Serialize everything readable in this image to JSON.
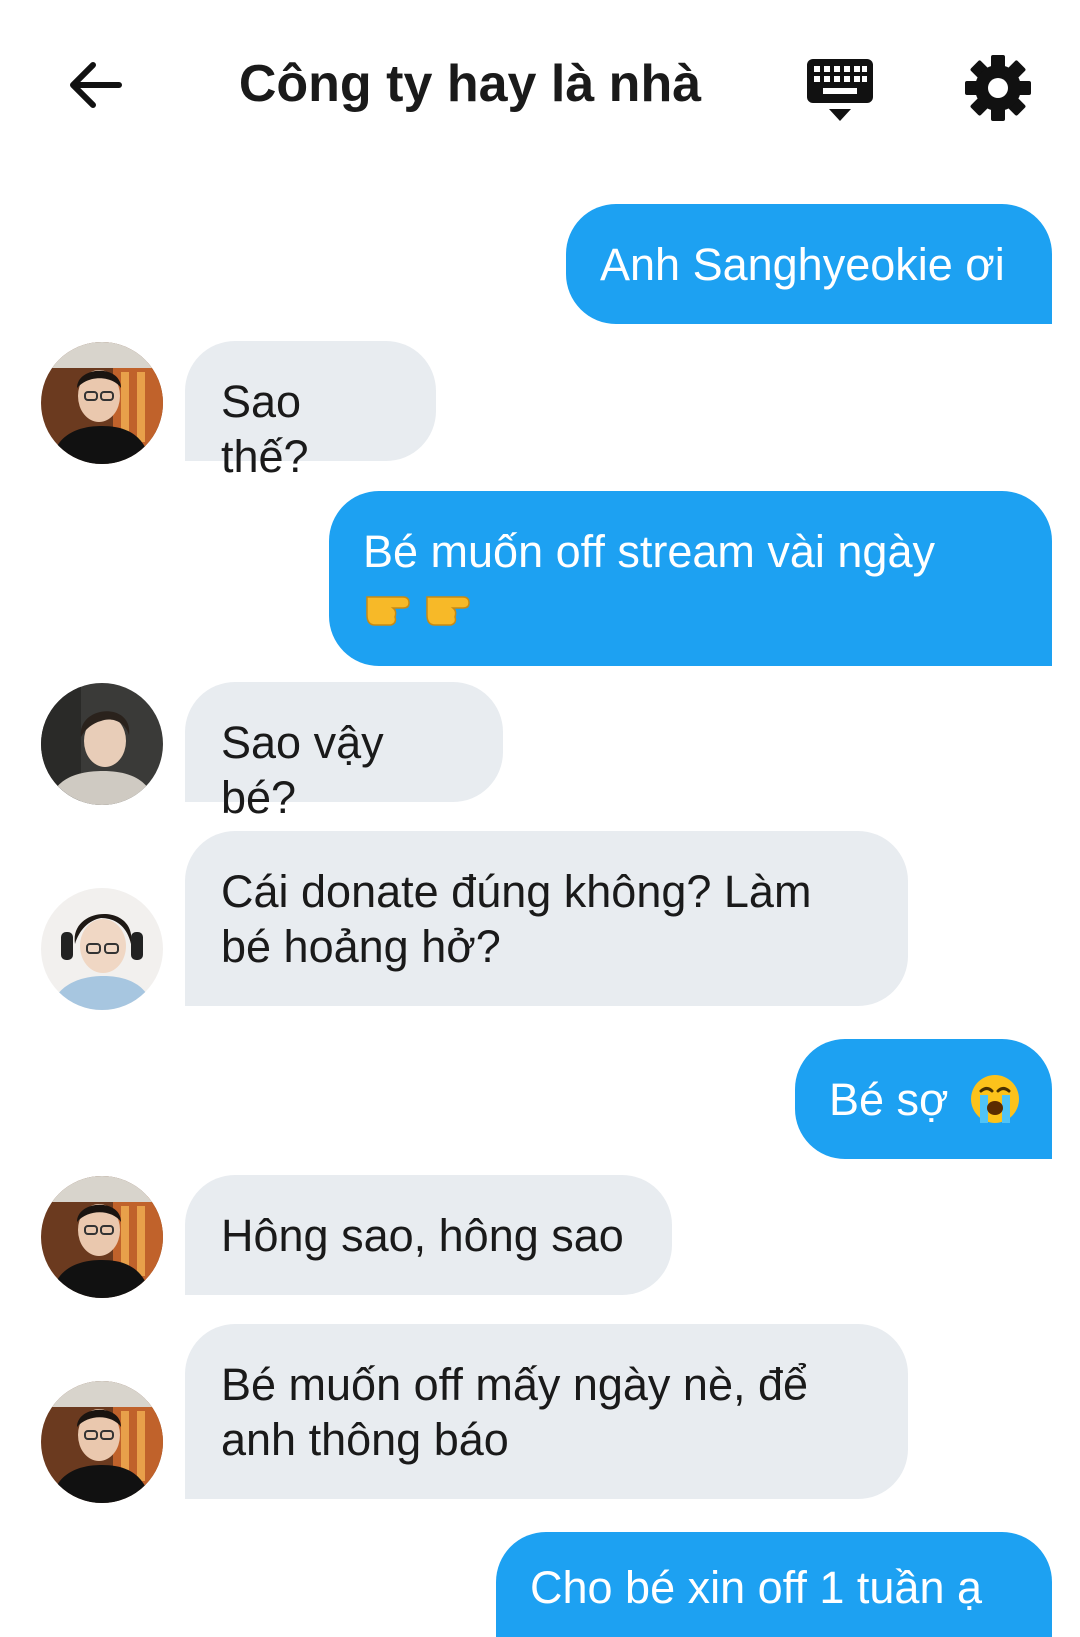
{
  "header": {
    "title": "Công ty hay là nhà",
    "back_icon": "arrow-left-icon",
    "keyboard_icon": "keyboard-hide-icon",
    "settings_icon": "gear-icon"
  },
  "colors": {
    "outgoing_bubble": "#1da1f2",
    "incoming_bubble": "#e8ecf0",
    "outgoing_text": "#ffffff",
    "incoming_text": "#1a1a1a"
  },
  "messages": [
    {
      "direction": "outgoing",
      "text": "Anh Sanghyeokie ơi"
    },
    {
      "direction": "incoming",
      "avatar": "avatar-man-glasses-black-shirt",
      "text": "Sao thế?"
    },
    {
      "direction": "outgoing",
      "text": "Bé muốn off stream vài ngày",
      "emoji": "👉👉"
    },
    {
      "direction": "incoming",
      "avatar": "avatar-man-grey-hoodie",
      "text": "Sao vậy bé?"
    },
    {
      "direction": "incoming",
      "avatar": "avatar-man-headphones-glasses",
      "text": "Cái donate đúng không? Làm bé hoảng hở?"
    },
    {
      "direction": "outgoing",
      "text": "Bé sợ",
      "emoji": "😭"
    },
    {
      "direction": "incoming",
      "avatar": "avatar-man-glasses-black-shirt",
      "text": "Hông sao, hông sao"
    },
    {
      "direction": "incoming",
      "avatar": "avatar-man-glasses-black-shirt",
      "text": "Bé muốn off mấy ngày nè, để anh thông báo"
    },
    {
      "direction": "outgoing",
      "text": "Cho bé xin off 1 tuần ạ"
    }
  ]
}
